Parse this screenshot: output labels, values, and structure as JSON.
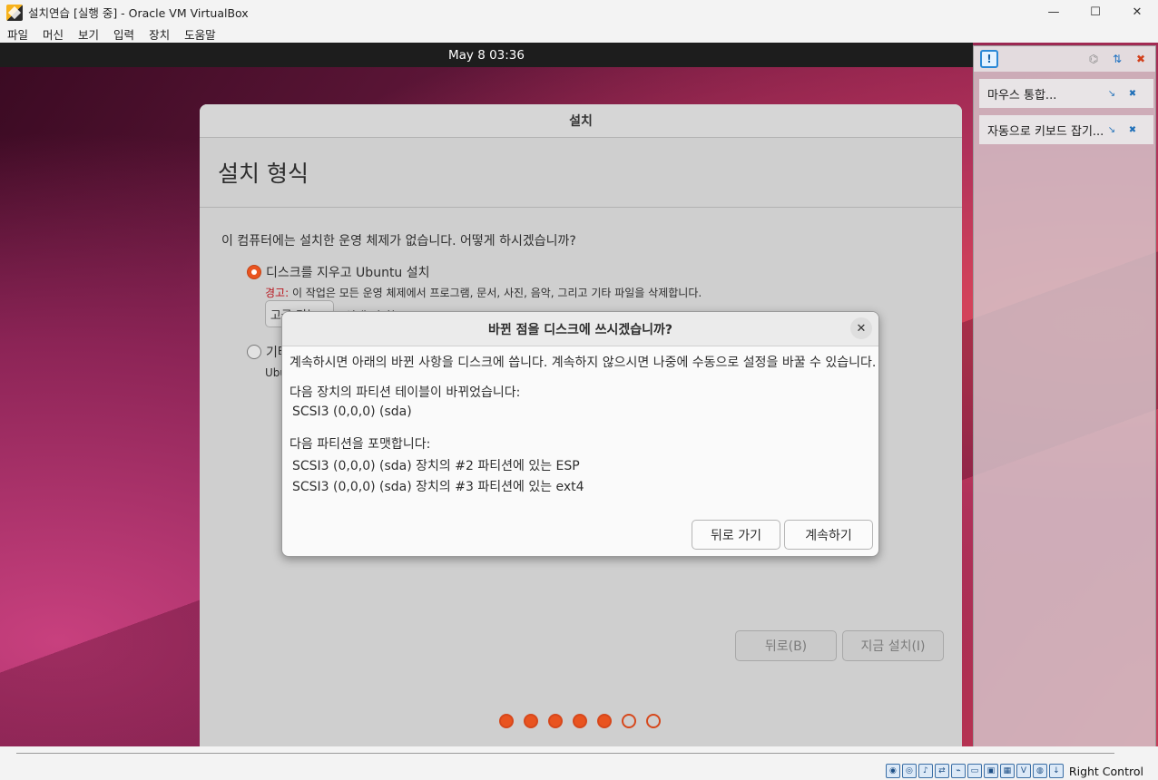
{
  "window": {
    "title": "설치연습 [실행 중] - Oracle VM VirtualBox",
    "minimize_glyph": "—",
    "maximize_glyph": "☐",
    "close_glyph": "✕"
  },
  "menubar": [
    "파일",
    "머신",
    "보기",
    "입력",
    "장치",
    "도움말"
  ],
  "guest_topbar": {
    "clock": "May 8  03:36"
  },
  "installer": {
    "title": "설치",
    "heading": "설치 형식",
    "question": "이 컴퓨터에는 설치한 운영 체제가 없습니다. 어떻게 하시겠습니까?",
    "option_erase": "디스크를 지우고 Ubuntu 설치",
    "warning_label": "경고:",
    "warning_text": " 이 작업은 모든 운영 체제에서 프로그램, 문서, 사진, 음악, 그리고 기타 파일을 삭제합니다.",
    "advanced_button": "고급 기능...",
    "advanced_status": "선택 안 함",
    "option_other": "기타",
    "option_other_sub": "Ubu",
    "back_button": "뒤로(B)",
    "install_button": "지금 설치(I)",
    "progress": {
      "total": 7,
      "completed": 5
    }
  },
  "dialog": {
    "title": "바뀐 점을 디스크에 쓰시겠습니까?",
    "close_glyph": "✕",
    "intro": "계속하시면 아래의 바뀐 사항을 디스크에 씁니다. 계속하지 않으시면 나중에 수동으로 설정을 바꿀 수 있습니다.",
    "table_changed_label": "다음 장치의 파티션 테이블이 바뀌었습니다:",
    "table_changed_device": "SCSI3 (0,0,0) (sda)",
    "format_label": "다음 파티션을 포맷합니다:",
    "format_items": [
      "SCSI3 (0,0,0) (sda) 장치의 #2 파티션에 있는 ESP",
      "SCSI3 (0,0,0) (sda) 장치의 #3 파티션에 있는 ext4"
    ],
    "back_button": "뒤로 가기",
    "continue_button": "계속하기"
  },
  "notifications": {
    "items": [
      "마우스 통합...",
      "자동으로 키보드 잡기..."
    ]
  },
  "statusbar": {
    "host_key": "Right Control"
  },
  "colors": {
    "accent": "#e95420",
    "warning": "#b8141c"
  }
}
